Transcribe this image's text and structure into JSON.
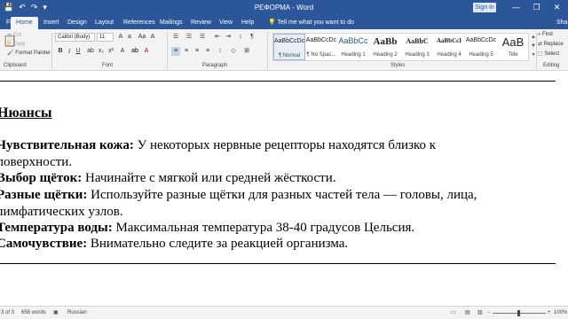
{
  "window": {
    "title": "РЕФОРМА  -  Word",
    "signin_label": "Sign in",
    "quick_access": [
      "💾",
      "↶",
      "↷",
      "▾"
    ],
    "controls": [
      "—",
      "❐",
      "✕"
    ]
  },
  "tabs": {
    "file": "File",
    "home": "Home",
    "insert": "Insert",
    "design": "Design",
    "layout": "Layout",
    "references": "References",
    "mailings": "Mailings",
    "review": "Review",
    "view": "View",
    "help": "Help",
    "tell_me": "Tell me what you want to do",
    "share": "Sha"
  },
  "clipboard": {
    "cut": "Cut",
    "copy": "Copy",
    "format_painter": "Format Painter",
    "label": "Clipboard"
  },
  "font": {
    "family": "Calibri (Body)",
    "size": "11",
    "bold": "B",
    "italic": "I",
    "underline": "U",
    "label": "Font"
  },
  "paragraph": {
    "label": "Paragraph"
  },
  "styles": {
    "label": "Styles",
    "items": [
      {
        "sample": "AaBbCcDc",
        "name": "¶ Normal"
      },
      {
        "sample": "AaBbCcDc",
        "name": "¶ No Spac..."
      },
      {
        "sample": "AaBbCc",
        "name": "Heading 1"
      },
      {
        "sample": "AaBb",
        "name": "Heading 2"
      },
      {
        "sample": "AaBbC",
        "name": "Heading 3"
      },
      {
        "sample": "AaBbCcI",
        "name": "Heading 4"
      },
      {
        "sample": "AaBbCcDc",
        "name": "Heading 5"
      },
      {
        "sample": "AaB",
        "name": "Title"
      }
    ]
  },
  "editing": {
    "find": "Find",
    "replace": "Replace",
    "select": "Select",
    "label": "Editing"
  },
  "document": {
    "heading": "Нюансы",
    "paragraphs": [
      {
        "bold": "Чувствительная кожа:",
        "text": " У некоторых нервные рецепторы находятся близко к"
      },
      {
        "bold": "",
        "text": "поверхности."
      },
      {
        "bold": "Выбор щёток:",
        "text": " Начинайте с мягкой или средней жёсткости."
      },
      {
        "bold": "Разные щётки:",
        "text": " Используйте разные щётки для разных частей тела — головы, лица,"
      },
      {
        "bold": "",
        "text": "лимфатических узлов."
      },
      {
        "bold": "Температура воды:",
        "text": " Максимальная температура 38-40 градусов Цельсия."
      },
      {
        "bold": "Самочувствие:",
        "text": " Внимательно следите за реакцией организма."
      }
    ]
  },
  "status": {
    "page": "3 of 3",
    "words": "658 words",
    "language": "Russian",
    "zoom": "100%"
  },
  "colors": {
    "word_blue": "#2b579a",
    "ribbon_bg": "#f3f3f3"
  }
}
